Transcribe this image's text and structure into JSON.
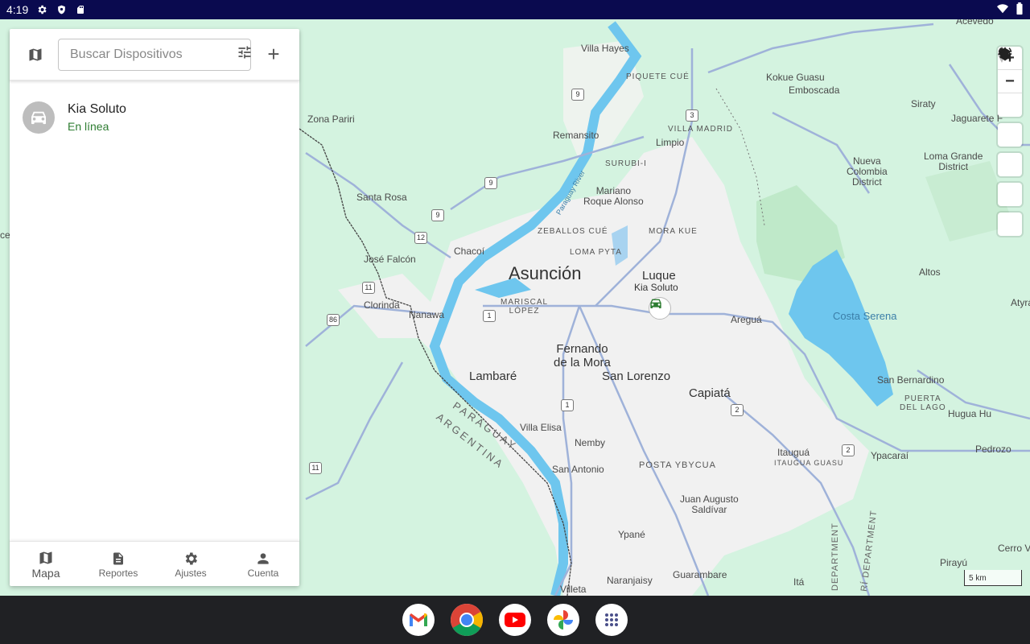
{
  "status_bar": {
    "time": "4:19"
  },
  "panel": {
    "search_placeholder": "Buscar Dispositivos",
    "add_label": "+",
    "devices": [
      {
        "name": "Kia Soluto",
        "status": "En línea"
      }
    ]
  },
  "bottom_nav": [
    {
      "label": "Mapa",
      "icon": "map-icon"
    },
    {
      "label": "Reportes",
      "icon": "document-icon"
    },
    {
      "label": "Ajustes",
      "icon": "gear-icon"
    },
    {
      "label": "Cuenta",
      "icon": "person-icon"
    }
  ],
  "map": {
    "marker_label": "Kia Soluto",
    "scale": "5 km",
    "labels": {
      "asuncion": "Asunción",
      "luque": "Luque",
      "fernando": "Fernando\nde la Mora",
      "lambare": "Lambaré",
      "san_lorenzo": "San Lorenzo",
      "capiata": "Capiatá",
      "villa_hayes": "Villa Hayes",
      "remansito": "Remansito",
      "limpio": "Limpio",
      "mariano": "Mariano\nRoque Alonso",
      "santa_rosa": "Santa Rosa",
      "zona_pariri": "Zona Pariri",
      "jose_falcon": "José Falcón",
      "chacoi": "Chacoí",
      "clorinda": "Clorinda",
      "nanawa": "Nanawa",
      "villa_elisa": "Villa Elisa",
      "nemby": "Nemby",
      "san_antonio": "San Antonio",
      "ypane": "Ypané",
      "villeta": "Villeta",
      "naranjaisy": "Naranjaisy",
      "guarambare": "Guarambare",
      "ita": "Itá",
      "juan_augusto": "Juan Augusto\nSaldívar",
      "itaugua": "Itauguá",
      "ypacarai": "Ypacaraí",
      "aregua": "Areguá",
      "costa_serena": "Costa Serena",
      "san_bernardino": "San Bernardino",
      "altos": "Altos",
      "nueva_colombia": "Nueva\nColombia\nDistrict",
      "loma_grande": "Loma Grande\nDistrict",
      "kokue": "Kokue Guasu",
      "emboscada": "Emboscada",
      "siraty": "Siraty",
      "jaguarete": "Jaguarete F",
      "hugua": "Hugua Hu",
      "pedrozo": "Pedrozo",
      "cerro": "Cerro V",
      "piraju": "Pirayú",
      "atyra": "Atyrá",
      "acevedo": "Acevedo",
      "piquete": "PIQUETE CUÉ",
      "villa_madrid": "VILLA MADRID",
      "surubii": "SURUBI-I",
      "zeballos": "ZEBALLOS CUÉ",
      "loma_pyta": "LOMA PYTA",
      "mora_kue": "MORA KUE",
      "mariscal": "MARISCAL\nLÓPEZ",
      "posta": "POSTA YBYCUA",
      "itaugua_guasu": "ITAUGUA GUASU",
      "puerta": "PUERTA\nDEL LAGO",
      "paraguay": "PARAGUAY",
      "argentina": "ARGENTINA",
      "department": "DEPARTMENT",
      "department2": "RÍ DEPARTMENT",
      "paraguay_river": "Paraguay River",
      "ce": "ce"
    },
    "route_shields": [
      "9",
      "9",
      "9",
      "12",
      "11",
      "86",
      "1",
      "1",
      "2",
      "2",
      "11",
      "3"
    ]
  },
  "shelf_apps": [
    "gmail-icon",
    "chrome-icon",
    "youtube-icon",
    "photos-icon",
    "launcher-icon"
  ],
  "colors": {
    "map_bg": "#d4f3e0",
    "urban": "#f2f2f2",
    "water": "#6ec6ee",
    "road": "#9fb2d9",
    "online": "#2e7d32",
    "status_bar": "#0a0a4f",
    "shelf": "#202124"
  }
}
